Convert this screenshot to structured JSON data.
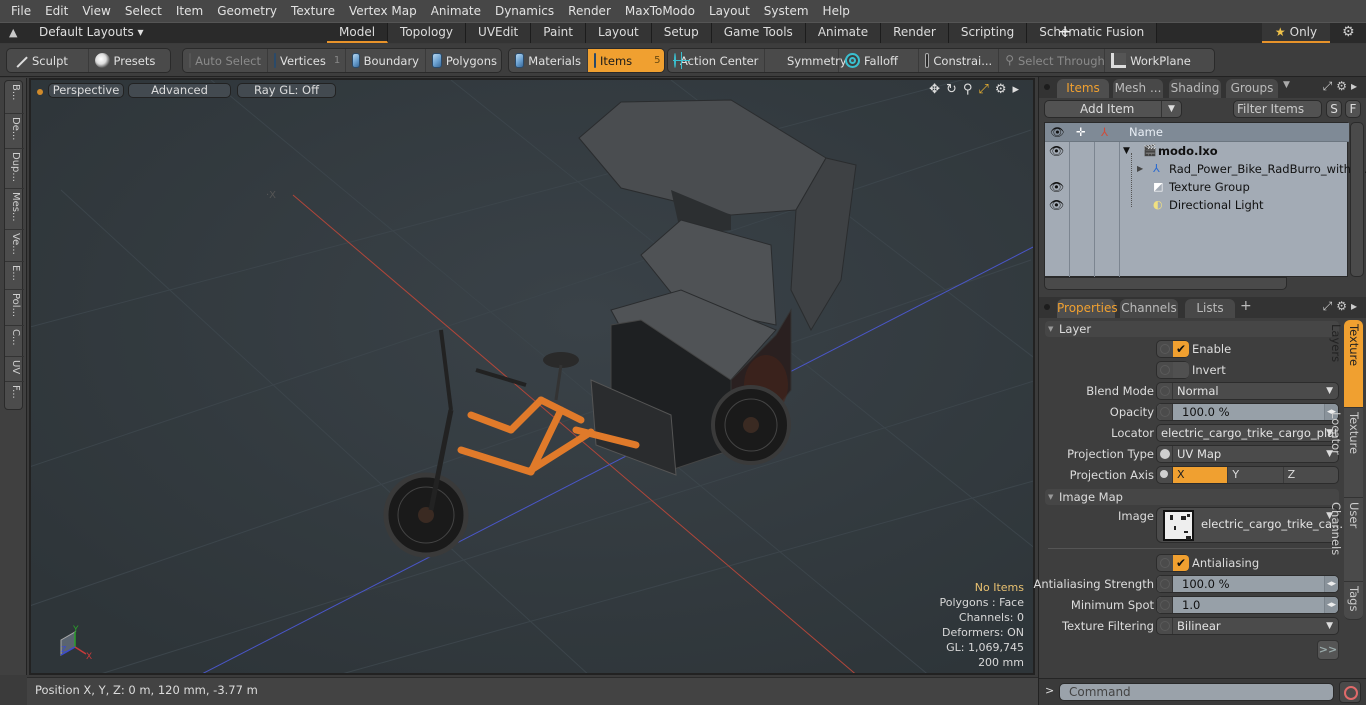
{
  "menu": [
    "File",
    "Edit",
    "View",
    "Select",
    "Item",
    "Geometry",
    "Texture",
    "Vertex Map",
    "Animate",
    "Dynamics",
    "Render",
    "MaxToModo",
    "Layout",
    "System",
    "Help"
  ],
  "layouts": {
    "label": "Default Layouts ▾",
    "tabs": [
      "Model",
      "Topology",
      "UVEdit",
      "Paint",
      "Layout",
      "Setup",
      "Game Tools",
      "Animate",
      "Render",
      "Scripting",
      "Schematic Fusion"
    ],
    "active_tab": "Model",
    "add_label": "+",
    "only_label": "Only"
  },
  "toolbar": {
    "sculpt": "Sculpt",
    "presets": "Presets",
    "auto_select": "Auto Select",
    "vertices": "Vertices",
    "vertices_count": "1",
    "boundary": "Boundary",
    "polygons": "Polygons",
    "materials": "Materials",
    "items": "Items",
    "items_count": "5",
    "action_center": "Action Center",
    "symmetry": "Symmetry",
    "falloff": "Falloff",
    "constraints": "Constrai...",
    "select_through": "Select Through",
    "workplane": "WorkPlane"
  },
  "left_tools": [
    "B...",
    "De...",
    "Dup...",
    "Mes...",
    "Ve...",
    "E...",
    "Pol...",
    "C...",
    "UV",
    "F..."
  ],
  "viewport": {
    "view_mode": "Perspective",
    "shading": "Advanced",
    "raygl": "Ray GL: Off",
    "stats": {
      "selection": "No Items",
      "polygons": "Polygons : Face",
      "channels": "Channels: 0",
      "deformers": "Deformers: ON",
      "gl": "GL: 1,069,745",
      "grid": "200 mm"
    },
    "axis_labels": {
      "x": "X",
      "y": "Y",
      "z": "Z"
    }
  },
  "status": {
    "position": "Position X, Y, Z:   0 m, 120 mm, -3.77 m"
  },
  "items_panel": {
    "tabs": [
      "Items",
      "Mesh ...",
      "Shading",
      "Groups"
    ],
    "active_tab": "Items",
    "add_item": "Add Item",
    "filter_placeholder": "Filter Items",
    "s_btn": "S",
    "f_btn": "F",
    "col_name": "Name",
    "tree": [
      {
        "name": "modo.lxo",
        "visible": true,
        "level": 0,
        "icon": "scene-icon",
        "bold": true
      },
      {
        "name": "Rad_Power_Bike_RadBurro_with_...",
        "visible": false,
        "level": 1,
        "icon": "locator-icon",
        "bold": false
      },
      {
        "name": "Texture Group",
        "visible": true,
        "level": 1,
        "icon": "texture-group-icon",
        "bold": false
      },
      {
        "name": "Directional Light",
        "visible": true,
        "level": 1,
        "icon": "light-icon",
        "bold": false
      }
    ]
  },
  "properties_panel": {
    "tabs": [
      "Properties",
      "Channels",
      "Lists"
    ],
    "active_tab": "Properties",
    "add_label": "+",
    "section_layer": "Layer",
    "enable_label": "Enable",
    "enable": true,
    "invert_label": "Invert",
    "invert": false,
    "blend_mode_label": "Blend Mode",
    "blend_mode": "Normal",
    "opacity_label": "Opacity",
    "opacity": "100.0 %",
    "locator_label": "Locator",
    "locator": "electric_cargo_trike_cargo_plat...",
    "projection_type_label": "Projection Type",
    "projection_type": "UV Map",
    "projection_axis_label": "Projection Axis",
    "projection_axis_options": [
      "X",
      "Y",
      "Z"
    ],
    "projection_axis": "X",
    "section_image_map": "Image Map",
    "image_label": "Image",
    "image": "electric_cargo_trike_ca...",
    "antialiasing_label": "Antialiasing",
    "antialiasing": true,
    "aa_strength_label": "Antialiasing Strength",
    "aa_strength": "100.0 %",
    "min_spot_label": "Minimum Spot",
    "min_spot": "1.0",
    "tex_filter_label": "Texture Filtering",
    "tex_filter": "Bilinear",
    "more_label": ">>",
    "side_tabs": [
      "Texture Layers",
      "Texture Locator",
      "User Channels",
      "Tags"
    ],
    "active_side_tab": "Texture Layers"
  },
  "command": {
    "prompt": ">",
    "placeholder": "Command"
  },
  "colors": {
    "accent": "#f0a030",
    "viewport_bg": "#31393e",
    "x_axis": "#c84a3a",
    "z_axis": "#4a5ad0"
  }
}
